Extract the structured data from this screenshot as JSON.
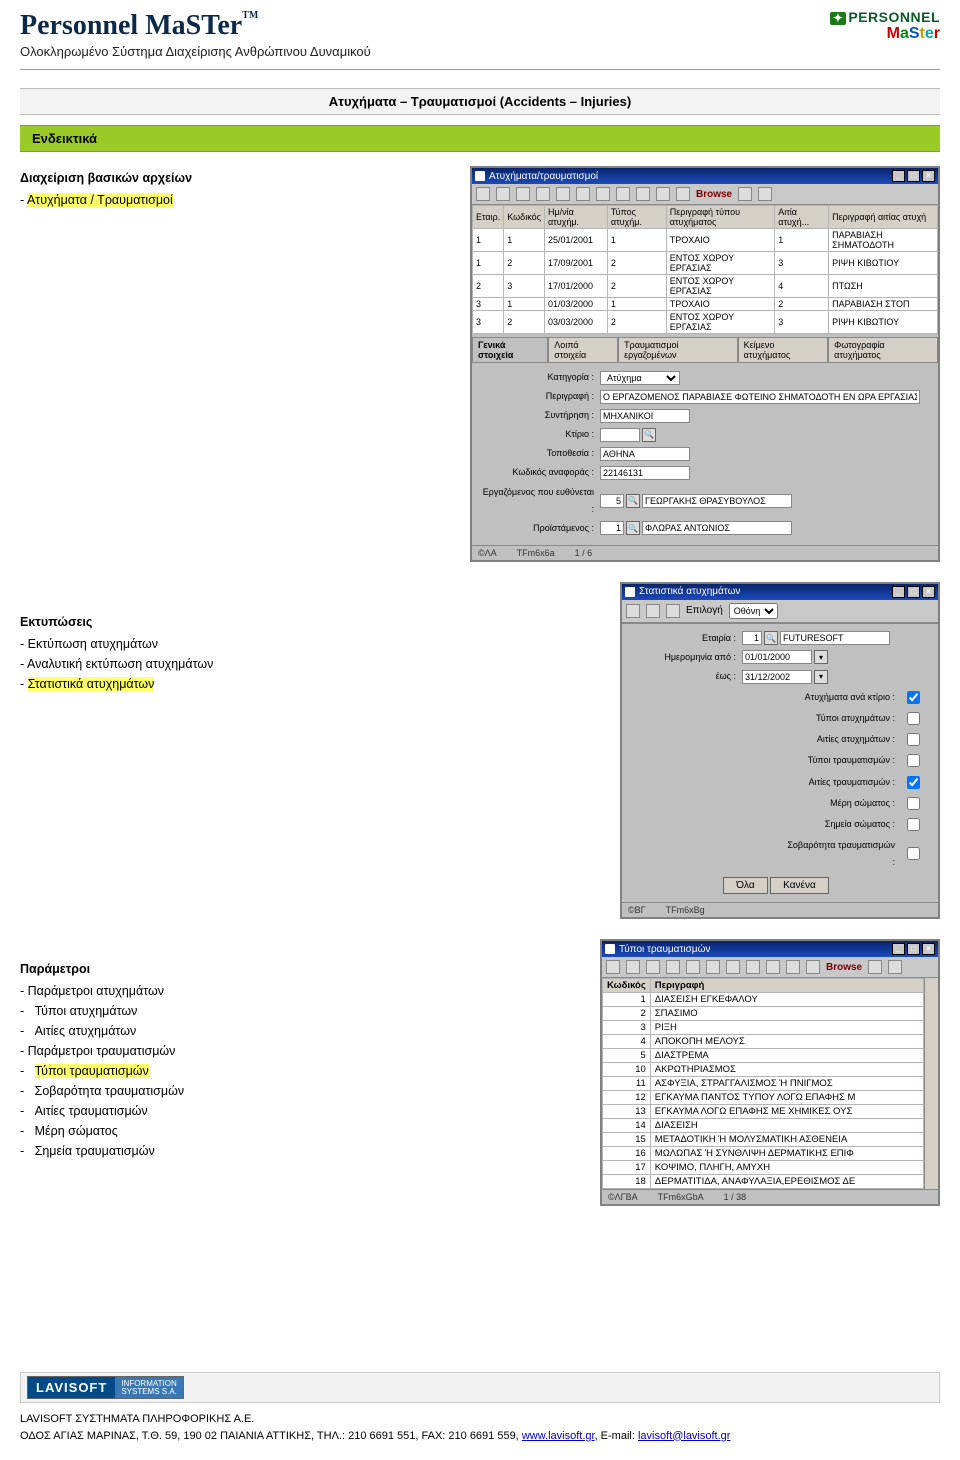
{
  "header": {
    "brand": "Personnel MaSTer",
    "tm": "TM",
    "subtitle": "Ολοκληρωμένο Σύστημα Διαχείρισης Ανθρώπινου Δυναμικού",
    "logo_top": "PERSONNEL",
    "logo_bottom_chars": [
      "M",
      "a",
      "S",
      "t",
      "e",
      "r"
    ]
  },
  "section": {
    "title_bar": "Ατυχήματα – Τραυματισμοί (Accidents – Injuries)",
    "green_bar": "Ενδεικτικά"
  },
  "block1": {
    "heading": "Διαχείριση βασικών αρχείων",
    "item": "Ατυχήματα / Τραυματισμοί"
  },
  "block2": {
    "heading": "Εκτυπώσεις",
    "items": [
      "Εκτύπωση ατυχημάτων",
      "Αναλυτική εκτύπωση ατυχημάτων"
    ],
    "highlight": "Στατιστικά ατυχημάτων"
  },
  "block3": {
    "heading": "Παράμετροι",
    "l1a": "Παράμετροι ατυχημάτων",
    "sub_a": [
      "Τύποι ατυχημάτων",
      "Αιτίες ατυχημάτων"
    ],
    "l1b": "Παράμετροι τραυματισμών",
    "hl_b": "Τύποι τραυματισμών",
    "sub_b": [
      "Σοβαρότητα τραυματισμών",
      "Αιτίες τραυματισμών",
      "Μέρη σώματος",
      "Σημεία τραυματισμών"
    ]
  },
  "win1": {
    "title": "Ατυχήματα/τραυματισμοί",
    "browse": "Browse",
    "grid_headers": [
      "Εταιρ.",
      "Κωδικός",
      "Ημ/νία ατυχήμ.",
      "Τύπος ατυχήμ.",
      "Περιγραφή τύπου ατυχήματος",
      "Αιτία ατυχή...",
      "Περιγραφή αιτίας ατυχή"
    ],
    "rows": [
      [
        "1",
        "1",
        "25/01/2001",
        "1",
        "ΤΡΟΧΑΙΟ",
        "1",
        "ΠΑΡΑΒΙΑΣΗ ΣΗΜΑΤΟΔΟΤΗ"
      ],
      [
        "1",
        "2",
        "17/09/2001",
        "2",
        "ΕΝΤΟΣ ΧΩΡΟΥ ΕΡΓΑΣΙΑΣ",
        "3",
        "ΡΙΨΗ ΚΙΒΩΤΙΟΥ"
      ],
      [
        "2",
        "3",
        "17/01/2000",
        "2",
        "ΕΝΤΟΣ ΧΩΡΟΥ ΕΡΓΑΣΙΑΣ",
        "4",
        "ΠΤΩΣΗ"
      ],
      [
        "3",
        "1",
        "01/03/2000",
        "1",
        "ΤΡΟΧΑΙΟ",
        "2",
        "ΠΑΡΑΒΙΑΣΗ ΣΤΟΠ"
      ],
      [
        "3",
        "2",
        "03/03/2000",
        "2",
        "ΕΝΤΟΣ ΧΩΡΟΥ ΕΡΓΑΣΙΑΣ",
        "3",
        "ΡΙΨΗ ΚΙΒΩΤΙΟΥ"
      ]
    ],
    "tabs": [
      "Γενικά στοιχεία",
      "Λοιπά στοιχεία",
      "Τραυματισμοί εργαζομένων",
      "Κείμενο ατυχήματος",
      "Φωτογραφία ατυχήματος"
    ],
    "form": {
      "cat_label": "Κατηγορία :",
      "cat_value": "Ατύχημα",
      "desc_label": "Περιγραφή :",
      "desc_value": "Ο ΕΡΓΑΖΟΜΕΝΟΣ ΠΑΡΑΒΙΑΣΕ ΦΩΤΕΙΝΟ ΣΗΜΑΤΟΔΟΤΗ ΕΝ ΩΡΑ ΕΡΓΑΣΙΑΣ ΚΑΙ ΣΥΓΚΡΟΥΣΤΗΚΕ ΜΕ ΕΠΕΡΧΟΜΕΝΟ ΟΧΗΜΑ",
      "srv_label": "Συντήρηση :",
      "srv_value": "ΜΗΧΑΝΙΚΟΙ",
      "build_label": "Κτίριο :",
      "build_value": "",
      "loc_label": "Τοποθεσία :",
      "loc_value": "ΑΘΗΝΑ",
      "ref_label": "Κωδικός αναφοράς :",
      "ref_value": "22146131",
      "resp_label": "Εργαζόμενος που ευθύνεται :",
      "resp_code": "5",
      "resp_value": "ΓΕΩΡΓΑΚΗΣ ΘΡΑΣΥΒΟΥΛΟΣ",
      "sup_label": "Προϊστάμενος :",
      "sup_code": "1",
      "sup_value": "ΦΛΩΡΑΣ ΑΝΤΩΝΙΟΣ"
    },
    "status": {
      "left": "©ΛΑ",
      "mid": "TFm6x6a",
      "right": "1 / 6"
    }
  },
  "win2": {
    "title": "Στατιστικά ατυχημάτων",
    "select_label": "Επιλογή",
    "select_value": "Οθόνη",
    "company_label": "Εταιρία :",
    "company_code": "1",
    "company_value": "FUTURESOFT",
    "from_label": "Ημερομηνία από :",
    "from_value": "01/01/2000",
    "to_label": "έως :",
    "to_value": "31/12/2002",
    "checks": [
      "Ατυχήματα ανά κτίριο :",
      "Τύποι ατυχημάτων :",
      "Αιτίες ατυχημάτων :",
      "Τύποι τραυματισμών :",
      "Αιτίες τραυματισμών :",
      "Μέρη σώματος :",
      "Σημεία σώματος :",
      "Σοβαρότητα τραυματισμών :"
    ],
    "check_states": [
      true,
      false,
      false,
      false,
      true,
      false,
      false,
      false
    ],
    "btn_all": "Όλα",
    "btn_none": "Κανένα",
    "status": {
      "left": "©ΒΓ",
      "mid": "TFm6xBg"
    }
  },
  "win3": {
    "title": "Τύποι τραυματισμών",
    "browse": "Browse",
    "headers": [
      "Κωδικός",
      "Περιγραφή"
    ],
    "rows": [
      [
        "1",
        "ΔΙΑΣΕΙΣΗ ΕΓΚΕΦΑΛΟΥ"
      ],
      [
        "2",
        "ΣΠΑΣΙΜΟ"
      ],
      [
        "3",
        "ΡΙΞΗ"
      ],
      [
        "4",
        "ΑΠΟΚΟΠΗ ΜΕΛΟΥΣ"
      ],
      [
        "5",
        "ΔΙΑΣΤΡΕΜΑ"
      ],
      [
        "10",
        "ΑΚΡΩΤΗΡΙΑΣΜΟΣ"
      ],
      [
        "11",
        "ΑΣΦΥΞΙΑ, ΣΤΡΑΓΓΑΛΙΣΜΟΣ Ή ΠΝΙΓΜΟΣ"
      ],
      [
        "12",
        "ΕΓΚΑΥΜΑ ΠΑΝΤΟΣ ΤΥΠΟΥ ΛΟΓΩ ΕΠΑΦΗΣ Μ"
      ],
      [
        "13",
        "ΕΓΚΑΥΜΑ ΛΟΓΩ ΕΠΑΦΗΣ ΜΕ ΧΗΜΙΚΕΣ ΟΥΣ"
      ],
      [
        "14",
        "ΔΙΑΣΕΙΣΗ"
      ],
      [
        "15",
        "ΜΕΤΑΔΟΤΙΚΗ Ή ΜΟΛΥΣΜΑΤΙΚΗ ΑΣΘΕΝΕΙΑ"
      ],
      [
        "16",
        "ΜΩΛΩΠΑΣ Ή ΣΥΝΘΛΙΨΗ ΔΕΡΜΑΤΙΚΗΣ ΕΠΙΦ"
      ],
      [
        "17",
        "ΚΟΨΙΜΟ, ΠΛΗΓΗ, ΑΜΥΧΗ"
      ],
      [
        "18",
        "ΔΕΡΜΑΤΙΤΙΔΑ, ΑΝΑΦΥΛΑΞΙΑ,ΕΡΕΘΙΣΜΟΣ ΔΕ"
      ]
    ],
    "status": {
      "left": "©ΛΓΒΑ",
      "mid": "TFm6xGbA",
      "right": "1 / 38"
    }
  },
  "footer": {
    "badge1": "LAVISOFT",
    "badge2a": "INFORMATION",
    "badge2b": "SYSTEMS S.A.",
    "line1": "LAVISOFT ΣΥΣΤΗΜΑΤΑ ΠΛΗΡΟΦΟΡΙΚΗΣ Α.Ε.",
    "line2_a": "ΟΔΟΣ ΑΓΙΑΣ ΜΑΡΙΝΑΣ, Τ.Θ. 59, 190 02 ΠΑΙΑΝΙΑ ΑΤΤΙΚΗΣ, ΤΗΛ.: 210 6691 551, FAX: 210 6691 559, ",
    "link1": "www.lavisoft.gr",
    "line2_b": ", E-mail: ",
    "link2": "lavisoft@lavisoft.gr"
  }
}
